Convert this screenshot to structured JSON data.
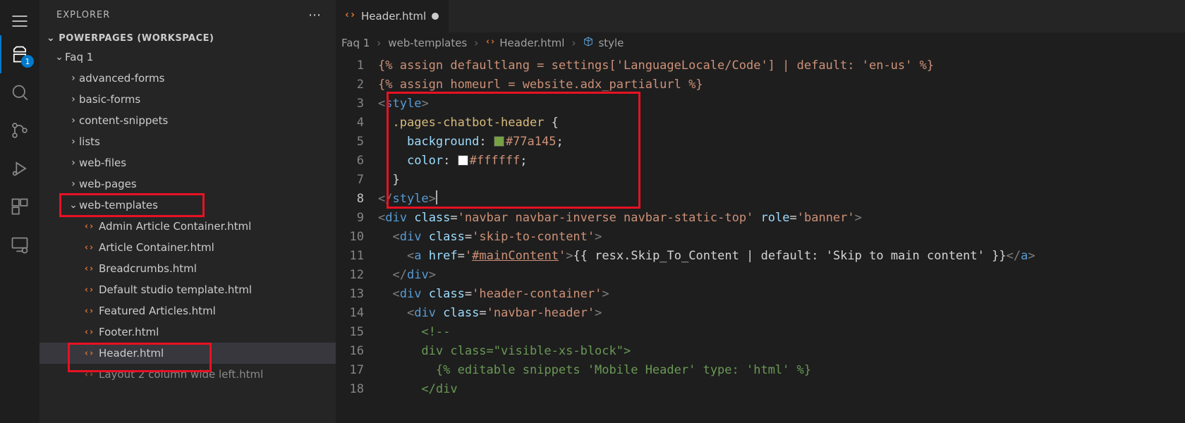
{
  "activitybar": {
    "explorer_badge": "1"
  },
  "sidebar": {
    "title": "EXPLORER",
    "workspace_label": "POWERPAGES (WORKSPACE)",
    "tree": {
      "root": "Faq 1",
      "folders": [
        "advanced-forms",
        "basic-forms",
        "content-snippets",
        "lists",
        "web-files",
        "web-pages"
      ],
      "web_templates_label": "web-templates",
      "files": [
        "Admin Article Container.html",
        "Article Container.html",
        "Breadcrumbs.html",
        "Default studio template.html",
        "Featured Articles.html",
        "Footer.html",
        "Header.html",
        "Layout 2 column wide left.html"
      ]
    }
  },
  "tab": {
    "label": "Header.html"
  },
  "breadcrumbs": {
    "items": [
      "Faq 1",
      "web-templates",
      "Header.html",
      "style"
    ]
  },
  "code": {
    "l1": "{% assign defaultlang = settings['LanguageLocale/Code'] | default: 'en-us' %}",
    "l2": "{% assign homeurl = website.adx_partialurl %}",
    "l3_tag": "style",
    "l4_selector": ".pages-chatbot-header",
    "l5_prop": "background",
    "l5_val_hex": "#77a145",
    "l6_prop": "color",
    "l6_val_hex": "#ffffff",
    "l9_class": "navbar navbar-inverse navbar-static-top",
    "l9_role": "banner",
    "l10_class": "skip-to-content",
    "l11_href": "#mainContent",
    "l11_expr": "{{ resx.Skip_To_Content | default: 'Skip to main content' }}",
    "l13_class": "header-container",
    "l14_class": "navbar-header",
    "l16_class": "visible-xs-block",
    "l17_text": "{% editable snippets 'Mobile Header' type: 'html' %}"
  }
}
